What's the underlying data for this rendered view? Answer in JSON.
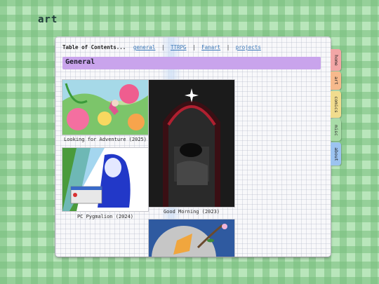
{
  "site": {
    "title": "art"
  },
  "toc": {
    "label": "Table of Contents...",
    "links": [
      "general",
      "TTRPG",
      "Fanart",
      "projects"
    ],
    "separator": "|"
  },
  "section": {
    "title": "General"
  },
  "gallery": [
    {
      "caption": "Looking for Adventure (2025)"
    },
    {
      "caption": "PC Pygmalion (2024)"
    },
    {
      "caption": "Good Morning (2023)"
    },
    {
      "caption": ""
    }
  ],
  "tabs": [
    {
      "label": "home",
      "color": "#f2a6a6"
    },
    {
      "label": "art",
      "color": "#f6b98c"
    },
    {
      "label": "comics",
      "color": "#f1dc8e"
    },
    {
      "label": "misc",
      "color": "#a9dca8"
    },
    {
      "label": "about",
      "color": "#9cc3f0"
    }
  ],
  "colors": {
    "background": "#b9e6bb",
    "section_header": "#c9a4ec",
    "link": "#3a78b8"
  }
}
